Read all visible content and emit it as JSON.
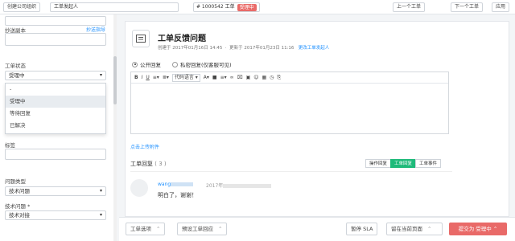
{
  "topbar": {
    "create_company_btn": "创建公司组织",
    "requester_label": "工单发起人",
    "ticket_number": "# 1000542 工单",
    "ticket_status": "受理中",
    "prev_btn": "上一个工单",
    "next_btn": "下一个工单",
    "apply_btn": "应用"
  },
  "sidebar": {
    "cc_label": "抄送副本",
    "cc_link": "抄送指导",
    "status_label": "工单状态",
    "status_value": "受理中",
    "status_options": [
      "-",
      "受理中",
      "等待回复",
      "已解决"
    ],
    "tags_label": "标签",
    "type_label": "问题类型",
    "type_value": "技术问题",
    "tech_label": "技术问题 *",
    "tech_value": "技术对接"
  },
  "ticket": {
    "title": "工单反馈问题",
    "meta_created": "创建于 2017年01月16日 14:45",
    "meta_updated": "更新于 2017年01月23日 11:16",
    "meta_link": "更改工单发起人",
    "reply_public": "公开回复",
    "reply_private": "私密回复(仅客服可见)",
    "font_select": "代码语言",
    "upload_link": "点击上传附件",
    "replies_title": "工单回复",
    "replies_count": "( 3 )",
    "tab_ops": "操作回复",
    "tab_replies": "工单回复",
    "tab_events": "工单事件",
    "reply_author": "wang",
    "reply_time": "2017年",
    "reply_text": "明白了，谢谢！"
  },
  "bottombar": {
    "ticket_options": "工单选项",
    "preset_ticket": "预设工单回应",
    "pause_sla": "暂停 SLA",
    "stay_page": "留在当前页面",
    "submit": "提交为 受理中"
  },
  "colors": {
    "accent_red": "#e96a68",
    "accent_green": "#1fba7a",
    "link_blue": "#1e90ff"
  }
}
